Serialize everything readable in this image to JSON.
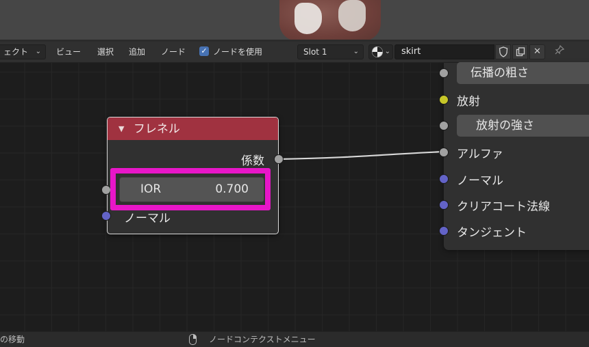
{
  "header": {
    "object_dropdown": "ェクト",
    "menus": [
      "ビュー",
      "選択",
      "追加",
      "ノード"
    ],
    "use_nodes_label": "ノードを使用",
    "use_nodes_checked": true,
    "slot_dropdown": "Slot 1",
    "material_name": "skirt",
    "icons": [
      "sphere-shading-icon",
      "fake-user-shield-icon",
      "duplicate-icon",
      "close-icon",
      "pin-icon"
    ]
  },
  "fresnel_node": {
    "title": "フレネル",
    "output_label": "係数",
    "ior_label": "IOR",
    "ior_value": "0.700",
    "normal_label": "ノーマル"
  },
  "bsdf_node": {
    "inputs": [
      {
        "label": "伝播の粗さ",
        "kind": "field",
        "socket": "grey"
      },
      {
        "label": "放射",
        "kind": "plain",
        "socket": "yellow"
      },
      {
        "label": "放射の強さ",
        "kind": "field",
        "socket": "grey"
      },
      {
        "label": "アルファ",
        "kind": "plain",
        "socket": "grey"
      },
      {
        "label": "ノーマル",
        "kind": "plain",
        "socket": "blue"
      },
      {
        "label": "クリアコート法線",
        "kind": "plain",
        "socket": "blue"
      },
      {
        "label": "タンジェント",
        "kind": "plain",
        "socket": "blue"
      }
    ]
  },
  "status_bar": {
    "left_text": "の移動",
    "context_menu_text": "ノードコンテクストメニュー"
  },
  "colors": {
    "highlight": "#e816c8",
    "fresnel_header": "#a03240",
    "socket_grey": "#a1a1a1",
    "socket_blue": "#6363c7",
    "socket_yellow": "#c7c729"
  }
}
